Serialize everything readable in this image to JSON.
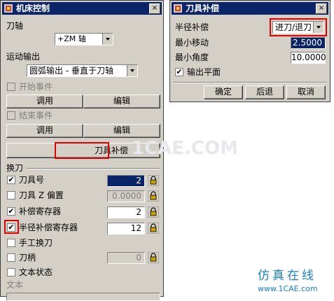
{
  "left_dialog": {
    "title": "机床控制",
    "close": "×",
    "tool_axis_label": "刀轴",
    "tool_axis_value": "+ZM 轴",
    "motion_output_label": "运动输出",
    "motion_output_value": "圆弧输出 - 垂直于刀轴",
    "start_event": {
      "label": "开始事件",
      "call": "调用",
      "edit": "编辑"
    },
    "end_event": {
      "label": "结束事件",
      "call": "调用",
      "edit": "编辑"
    },
    "cutter_comp_button": "刀具补偿",
    "tool_change_label": "换刀",
    "rows": [
      {
        "label": "刀具号",
        "checked": "✔",
        "value": "2"
      },
      {
        "label": "刀具 Z 偏置",
        "checked": "",
        "value": "0.0000"
      },
      {
        "label": "补偿寄存器",
        "checked": "✔",
        "value": "2"
      },
      {
        "label": "半径补偿寄存器",
        "checked": "✔",
        "value": "12"
      },
      {
        "label": "手工换刀",
        "checked": ""
      },
      {
        "label": "刀柄",
        "checked": "",
        "value": "0"
      },
      {
        "label": "文本状态",
        "checked": ""
      }
    ],
    "text_label": "文本"
  },
  "right_dialog": {
    "title": "刀具补偿",
    "close": "×",
    "radius_comp_label": "半径补偿",
    "radius_comp_value": "进刀/退刀",
    "min_move_label": "最小移动",
    "min_move_value": "2.5000",
    "min_angle_label": "最小角度",
    "min_angle_value": "10.0000",
    "output_plane_label": "输出平面",
    "output_plane_checked": "✔",
    "ok": "确定",
    "back": "后退",
    "cancel": "取消"
  },
  "watermark": {
    "center": "1CAE.COM",
    "brand_cn": "仿真在线",
    "brand_url": "www.1CAE.com"
  },
  "colors": {
    "titlebar": "#0a246a",
    "dialog_bg": "#d4d0c8",
    "highlight_box": "#e00000",
    "brand": "#1a7fc8"
  }
}
